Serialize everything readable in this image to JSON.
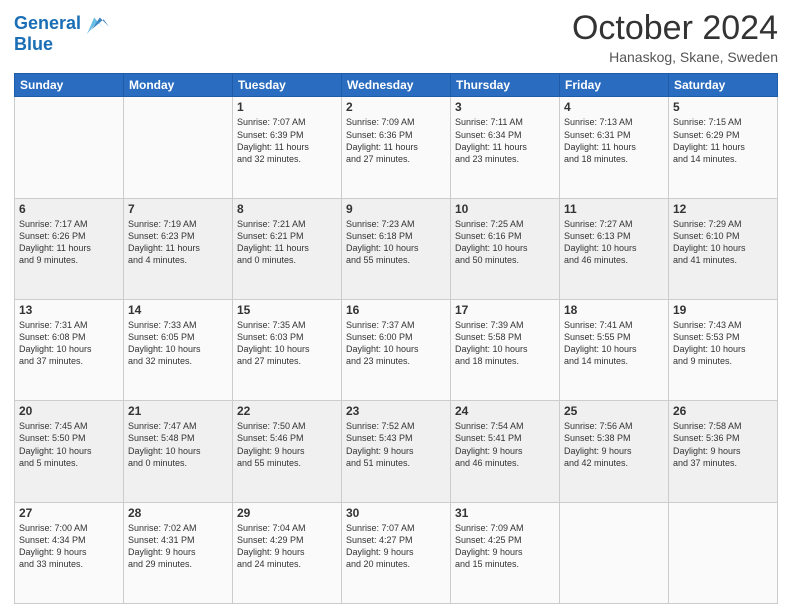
{
  "header": {
    "logo_line1": "General",
    "logo_line2": "Blue",
    "month": "October 2024",
    "location": "Hanaskog, Skane, Sweden"
  },
  "days_of_week": [
    "Sunday",
    "Monday",
    "Tuesday",
    "Wednesday",
    "Thursday",
    "Friday",
    "Saturday"
  ],
  "weeks": [
    [
      {
        "day": "",
        "info": ""
      },
      {
        "day": "",
        "info": ""
      },
      {
        "day": "1",
        "info": "Sunrise: 7:07 AM\nSunset: 6:39 PM\nDaylight: 11 hours\nand 32 minutes."
      },
      {
        "day": "2",
        "info": "Sunrise: 7:09 AM\nSunset: 6:36 PM\nDaylight: 11 hours\nand 27 minutes."
      },
      {
        "day": "3",
        "info": "Sunrise: 7:11 AM\nSunset: 6:34 PM\nDaylight: 11 hours\nand 23 minutes."
      },
      {
        "day": "4",
        "info": "Sunrise: 7:13 AM\nSunset: 6:31 PM\nDaylight: 11 hours\nand 18 minutes."
      },
      {
        "day": "5",
        "info": "Sunrise: 7:15 AM\nSunset: 6:29 PM\nDaylight: 11 hours\nand 14 minutes."
      }
    ],
    [
      {
        "day": "6",
        "info": "Sunrise: 7:17 AM\nSunset: 6:26 PM\nDaylight: 11 hours\nand 9 minutes."
      },
      {
        "day": "7",
        "info": "Sunrise: 7:19 AM\nSunset: 6:23 PM\nDaylight: 11 hours\nand 4 minutes."
      },
      {
        "day": "8",
        "info": "Sunrise: 7:21 AM\nSunset: 6:21 PM\nDaylight: 11 hours\nand 0 minutes."
      },
      {
        "day": "9",
        "info": "Sunrise: 7:23 AM\nSunset: 6:18 PM\nDaylight: 10 hours\nand 55 minutes."
      },
      {
        "day": "10",
        "info": "Sunrise: 7:25 AM\nSunset: 6:16 PM\nDaylight: 10 hours\nand 50 minutes."
      },
      {
        "day": "11",
        "info": "Sunrise: 7:27 AM\nSunset: 6:13 PM\nDaylight: 10 hours\nand 46 minutes."
      },
      {
        "day": "12",
        "info": "Sunrise: 7:29 AM\nSunset: 6:10 PM\nDaylight: 10 hours\nand 41 minutes."
      }
    ],
    [
      {
        "day": "13",
        "info": "Sunrise: 7:31 AM\nSunset: 6:08 PM\nDaylight: 10 hours\nand 37 minutes."
      },
      {
        "day": "14",
        "info": "Sunrise: 7:33 AM\nSunset: 6:05 PM\nDaylight: 10 hours\nand 32 minutes."
      },
      {
        "day": "15",
        "info": "Sunrise: 7:35 AM\nSunset: 6:03 PM\nDaylight: 10 hours\nand 27 minutes."
      },
      {
        "day": "16",
        "info": "Sunrise: 7:37 AM\nSunset: 6:00 PM\nDaylight: 10 hours\nand 23 minutes."
      },
      {
        "day": "17",
        "info": "Sunrise: 7:39 AM\nSunset: 5:58 PM\nDaylight: 10 hours\nand 18 minutes."
      },
      {
        "day": "18",
        "info": "Sunrise: 7:41 AM\nSunset: 5:55 PM\nDaylight: 10 hours\nand 14 minutes."
      },
      {
        "day": "19",
        "info": "Sunrise: 7:43 AM\nSunset: 5:53 PM\nDaylight: 10 hours\nand 9 minutes."
      }
    ],
    [
      {
        "day": "20",
        "info": "Sunrise: 7:45 AM\nSunset: 5:50 PM\nDaylight: 10 hours\nand 5 minutes."
      },
      {
        "day": "21",
        "info": "Sunrise: 7:47 AM\nSunset: 5:48 PM\nDaylight: 10 hours\nand 0 minutes."
      },
      {
        "day": "22",
        "info": "Sunrise: 7:50 AM\nSunset: 5:46 PM\nDaylight: 9 hours\nand 55 minutes."
      },
      {
        "day": "23",
        "info": "Sunrise: 7:52 AM\nSunset: 5:43 PM\nDaylight: 9 hours\nand 51 minutes."
      },
      {
        "day": "24",
        "info": "Sunrise: 7:54 AM\nSunset: 5:41 PM\nDaylight: 9 hours\nand 46 minutes."
      },
      {
        "day": "25",
        "info": "Sunrise: 7:56 AM\nSunset: 5:38 PM\nDaylight: 9 hours\nand 42 minutes."
      },
      {
        "day": "26",
        "info": "Sunrise: 7:58 AM\nSunset: 5:36 PM\nDaylight: 9 hours\nand 37 minutes."
      }
    ],
    [
      {
        "day": "27",
        "info": "Sunrise: 7:00 AM\nSunset: 4:34 PM\nDaylight: 9 hours\nand 33 minutes."
      },
      {
        "day": "28",
        "info": "Sunrise: 7:02 AM\nSunset: 4:31 PM\nDaylight: 9 hours\nand 29 minutes."
      },
      {
        "day": "29",
        "info": "Sunrise: 7:04 AM\nSunset: 4:29 PM\nDaylight: 9 hours\nand 24 minutes."
      },
      {
        "day": "30",
        "info": "Sunrise: 7:07 AM\nSunset: 4:27 PM\nDaylight: 9 hours\nand 20 minutes."
      },
      {
        "day": "31",
        "info": "Sunrise: 7:09 AM\nSunset: 4:25 PM\nDaylight: 9 hours\nand 15 minutes."
      },
      {
        "day": "",
        "info": ""
      },
      {
        "day": "",
        "info": ""
      }
    ]
  ]
}
